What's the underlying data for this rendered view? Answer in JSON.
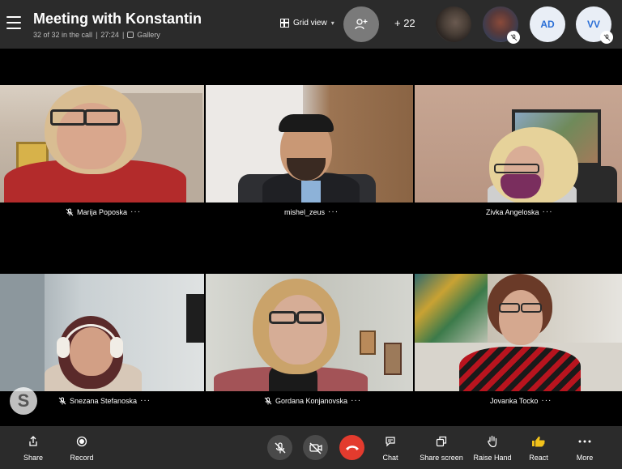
{
  "header": {
    "title": "Meeting with Konstantin",
    "subtitle_count": "32 of 32 in the call",
    "subtitle_time": "27:24",
    "subtitle_view": "Gallery",
    "grid_view_label": "Grid view",
    "more_participants": "+ 22",
    "avatars": [
      {
        "initials": "AD"
      },
      {
        "initials": "VV"
      }
    ]
  },
  "participants": [
    {
      "name": "Marija Poposka",
      "muted": true
    },
    {
      "name": "mishel_zeus",
      "muted": false
    },
    {
      "name": "Zivka Angeloska",
      "muted": false
    },
    {
      "name": "Snezana Stefanoska",
      "muted": true
    },
    {
      "name": "Gordana Konjanovska",
      "muted": true
    },
    {
      "name": "Jovanka Tocko",
      "muted": false
    }
  ],
  "more_dots": "···",
  "toolbar": {
    "share": "Share",
    "record": "Record",
    "chat": "Chat",
    "share_screen": "Share screen",
    "raise_hand": "Raise Hand",
    "react": "React",
    "more": "More"
  },
  "colors": {
    "header_bg": "#2b2b2b",
    "end_call": "#e33b2e",
    "avatar_text": "#2b6fd6"
  }
}
